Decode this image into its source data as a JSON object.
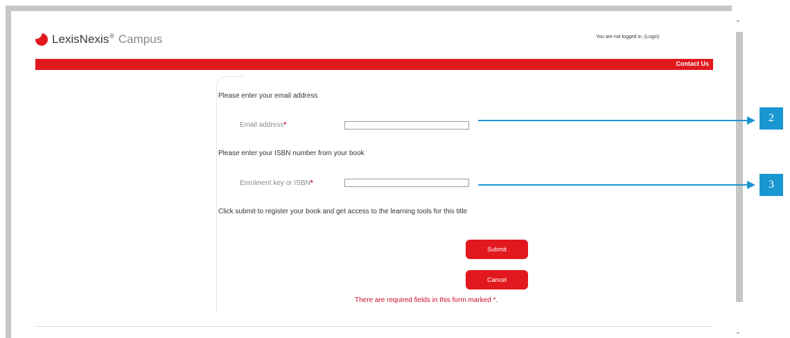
{
  "header": {
    "brand": "LexisNexis",
    "brand_mark": "®",
    "product": "Campus",
    "login_status": "You are not logged in. (Login)",
    "contact_us": "Contact Us",
    "accent_color": "#e1191f"
  },
  "form": {
    "email_heading": "Please enter your email address",
    "email_label": "Email address",
    "email_value": "",
    "isbn_heading": "Please enter your ISBN number from your book",
    "isbn_label": "Enrolment key or ISBN",
    "isbn_value": "",
    "required_marker": "*",
    "submit_instruction": "Click submit to register your book and get access to the learning tools for this title",
    "submit_label": "Submit",
    "cancel_label": "Cancel",
    "error_message": "There are required fields in this form marked *."
  },
  "callouts": [
    {
      "number": "2"
    },
    {
      "number": "3"
    }
  ],
  "callout_color": "#1a96d1",
  "icons": {
    "logo": "lexisnexis-logo-icon",
    "scroll_up": "chevron-up-icon",
    "scroll_down": "chevron-down-icon"
  }
}
